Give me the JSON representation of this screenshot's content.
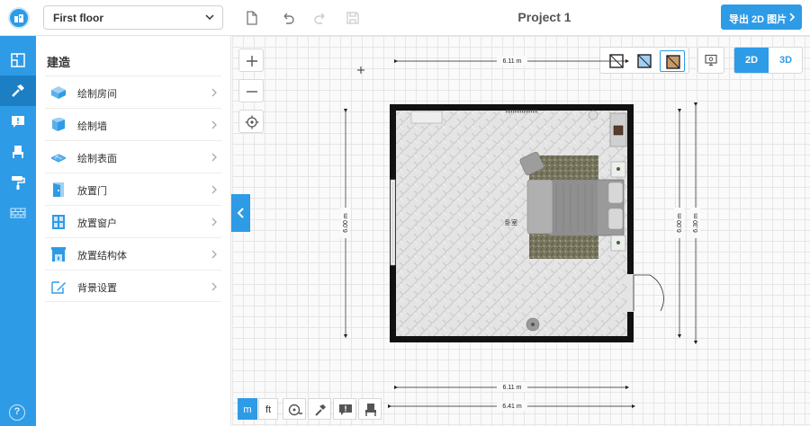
{
  "app": {
    "floor_selector": {
      "value": "First floor"
    },
    "project_title": "Project 1",
    "export_button": "导出 2D 图片"
  },
  "sidebar": {
    "title": "建造",
    "items": [
      {
        "label": "绘制房间",
        "icon": "room-cube-icon"
      },
      {
        "label": "绘制墙",
        "icon": "wall-icon"
      },
      {
        "label": "绘制表面",
        "icon": "surface-icon"
      },
      {
        "label": "放置门",
        "icon": "door-icon"
      },
      {
        "label": "放置窗户",
        "icon": "window-icon"
      },
      {
        "label": "放置结构体",
        "icon": "fireplace-icon"
      },
      {
        "label": "背景设置",
        "icon": "edit-background-icon"
      }
    ]
  },
  "rail": {
    "items": [
      "floorplan-icon",
      "hammer-icon",
      "comment-icon",
      "chair-icon",
      "paint-roller-icon",
      "brick-wall-icon"
    ],
    "help": "?"
  },
  "canvas": {
    "view_mode": {
      "two_d": "2D",
      "three_d": "3D",
      "active": "2D"
    },
    "room_label": "卧室",
    "dimensions": {
      "top": "6.11 m",
      "bottom_inner": "6.11 m",
      "bottom_outer": "6.41 m",
      "left": "6.00 m",
      "right_inner": "6.00 m",
      "right_outer": "6.30 m"
    },
    "units": {
      "metric": "m",
      "imperial": "ft",
      "active": "m"
    }
  },
  "colors": {
    "accent": "#2e9be6",
    "accent_dark": "#1c7fc4",
    "wall": "#111111",
    "rug": "#7a7860"
  }
}
